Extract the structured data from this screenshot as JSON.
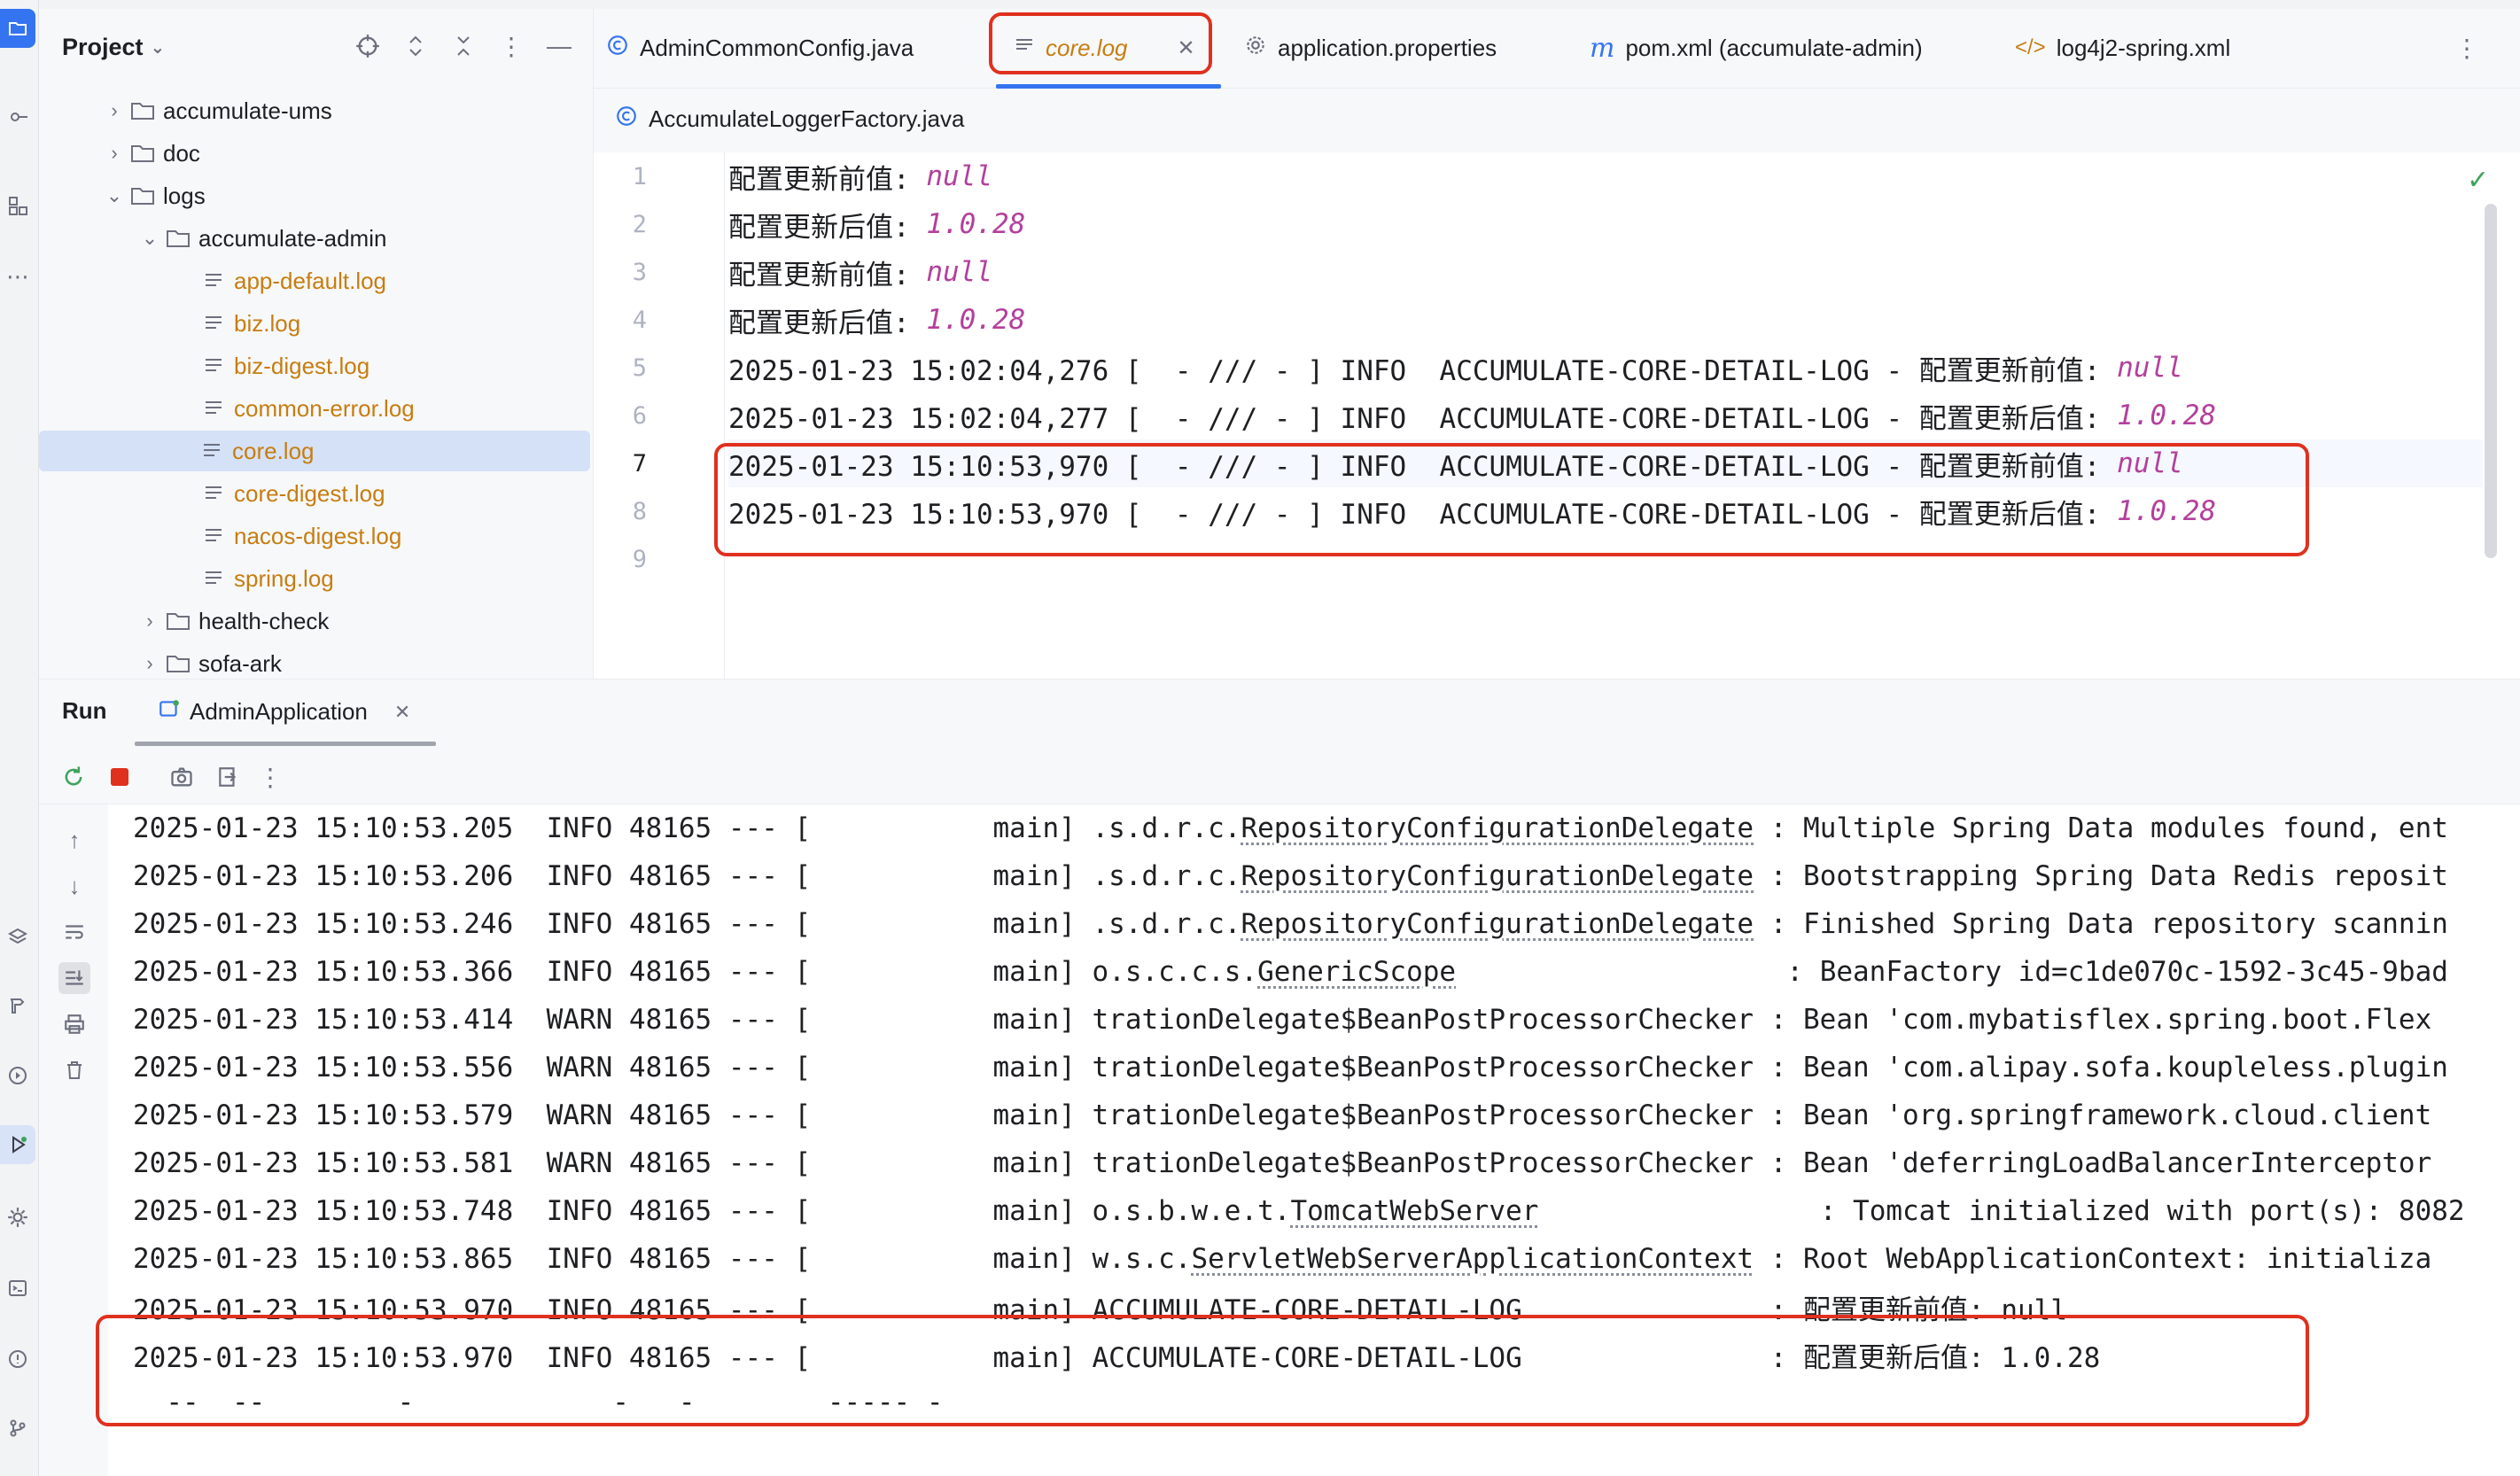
{
  "project": {
    "title": "Project",
    "tree": [
      {
        "label": "accumulate-ums",
        "type": "folder",
        "state": "collapsed"
      },
      {
        "label": "doc",
        "type": "folder",
        "state": "collapsed"
      },
      {
        "label": "logs",
        "type": "folder",
        "state": "expanded"
      },
      {
        "label": "accumulate-admin",
        "type": "folder",
        "state": "expanded"
      },
      {
        "label": "app-default.log",
        "type": "log"
      },
      {
        "label": "biz.log",
        "type": "log"
      },
      {
        "label": "biz-digest.log",
        "type": "log"
      },
      {
        "label": "common-error.log",
        "type": "log"
      },
      {
        "label": "core.log",
        "type": "log",
        "selected": true
      },
      {
        "label": "core-digest.log",
        "type": "log"
      },
      {
        "label": "nacos-digest.log",
        "type": "log"
      },
      {
        "label": "spring.log",
        "type": "log"
      },
      {
        "label": "health-check",
        "type": "folder",
        "state": "collapsed"
      },
      {
        "label": "sofa-ark",
        "type": "folder",
        "state": "collapsed"
      }
    ]
  },
  "tabs": [
    {
      "label": "AdminCommonConfig.java",
      "icon": "java-class-icon"
    },
    {
      "label": "core.log",
      "icon": "log-file-icon",
      "active": true
    },
    {
      "label": "application.properties",
      "icon": "properties-gear-icon"
    },
    {
      "label": "pom.xml (accumulate-admin)",
      "icon": "maven-icon"
    },
    {
      "label": "log4j2-spring.xml",
      "icon": "xml-icon"
    }
  ],
  "subtab": {
    "label": "AccumulateLoggerFactory.java"
  },
  "editor": {
    "lines": [
      {
        "num": "1",
        "text": "配置更新前值: ",
        "value": "null"
      },
      {
        "num": "2",
        "text": "配置更新后值: ",
        "value": "1.0.28"
      },
      {
        "num": "3",
        "text": "配置更新前值: ",
        "value": "null"
      },
      {
        "num": "4",
        "text": "配置更新后值: ",
        "value": "1.0.28"
      },
      {
        "num": "5",
        "text": "2025-01-23 15:02:04,276 [  - /// - ] INFO  ACCUMULATE-CORE-DETAIL-LOG - 配置更新前值: ",
        "value": "null"
      },
      {
        "num": "6",
        "text": "2025-01-23 15:02:04,277 [  - /// - ] INFO  ACCUMULATE-CORE-DETAIL-LOG - 配置更新后值: ",
        "value": "1.0.28"
      },
      {
        "num": "7",
        "text": "2025-01-23 15:10:53,970 [  - /// - ] INFO  ACCUMULATE-CORE-DETAIL-LOG - 配置更新前值: ",
        "value": "null"
      },
      {
        "num": "8",
        "text": "2025-01-23 15:10:53,970 [  - /// - ] INFO  ACCUMULATE-CORE-DETAIL-LOG - 配置更新后值: ",
        "value": "1.0.28"
      },
      {
        "num": "9",
        "text": "",
        "value": ""
      }
    ]
  },
  "run": {
    "title": "Run",
    "tab": "AdminApplication"
  },
  "console": {
    "lines": [
      {
        "prefix": "2025-01-23 15:10:53.205  INFO 48165 --- [           main] .s.d.r.c.",
        "link": "RepositoryConfigurationDelegate",
        "suffix": " : Multiple Spring Data modules found, ent"
      },
      {
        "prefix": "2025-01-23 15:10:53.206  INFO 48165 --- [           main] .s.d.r.c.",
        "link": "RepositoryConfigurationDelegate",
        "suffix": " : Bootstrapping Spring Data Redis reposit"
      },
      {
        "prefix": "2025-01-23 15:10:53.246  INFO 48165 --- [           main] .s.d.r.c.",
        "link": "RepositoryConfigurationDelegate",
        "suffix": " : Finished Spring Data repository scannin"
      },
      {
        "prefix": "2025-01-23 15:10:53.366  INFO 48165 --- [           main] o.s.c.c.s.",
        "link": "GenericScope",
        "suffix": "                    : BeanFactory id=c1de070c-1592-3c45-9bad"
      },
      {
        "prefix": "2025-01-23 15:10:53.414  WARN 48165 --- [           main] trationDelegate$BeanPostProcessorChecker : Bean 'com.mybatisflex.spring.boot.Flex",
        "link": "",
        "suffix": ""
      },
      {
        "prefix": "2025-01-23 15:10:53.556  WARN 48165 --- [           main] trationDelegate$BeanPostProcessorChecker : Bean 'com.alipay.sofa.koupleless.plugin",
        "link": "",
        "suffix": ""
      },
      {
        "prefix": "2025-01-23 15:10:53.579  WARN 48165 --- [           main] trationDelegate$BeanPostProcessorChecker : Bean 'org.springframework.cloud.client",
        "link": "",
        "suffix": ""
      },
      {
        "prefix": "2025-01-23 15:10:53.581  WARN 48165 --- [           main] trationDelegate$BeanPostProcessorChecker : Bean 'deferringLoadBalancerInterceptor",
        "link": "",
        "suffix": ""
      },
      {
        "prefix": "2025-01-23 15:10:53.748  INFO 48165 --- [           main] o.s.b.w.e.t.",
        "link": "TomcatWebServer",
        "suffix": "                 : Tomcat initialized with port(s): 8082"
      },
      {
        "prefix": "2025-01-23 15:10:53.865  INFO 48165 --- [           main] w.s.c.",
        "link": "ServletWebServerApplicationContext",
        "suffix": " : Root WebApplicationContext: initializa"
      },
      {
        "prefix": "2025-01-23 15:10:53.970  INFO 48165 --- [           main] ACCUMULATE-CORE-DETAIL-LOG               : 配置更新前值: null",
        "link": "",
        "suffix": ""
      },
      {
        "prefix": "2025-01-23 15:10:53.970  INFO 48165 --- [           main] ACCUMULATE-CORE-DETAIL-LOG               : 配置更新后值: 1.0.28",
        "link": "",
        "suffix": ""
      },
      {
        "prefix": "  --  --        -            -   -        ----- -",
        "link": "",
        "suffix": ""
      }
    ]
  }
}
